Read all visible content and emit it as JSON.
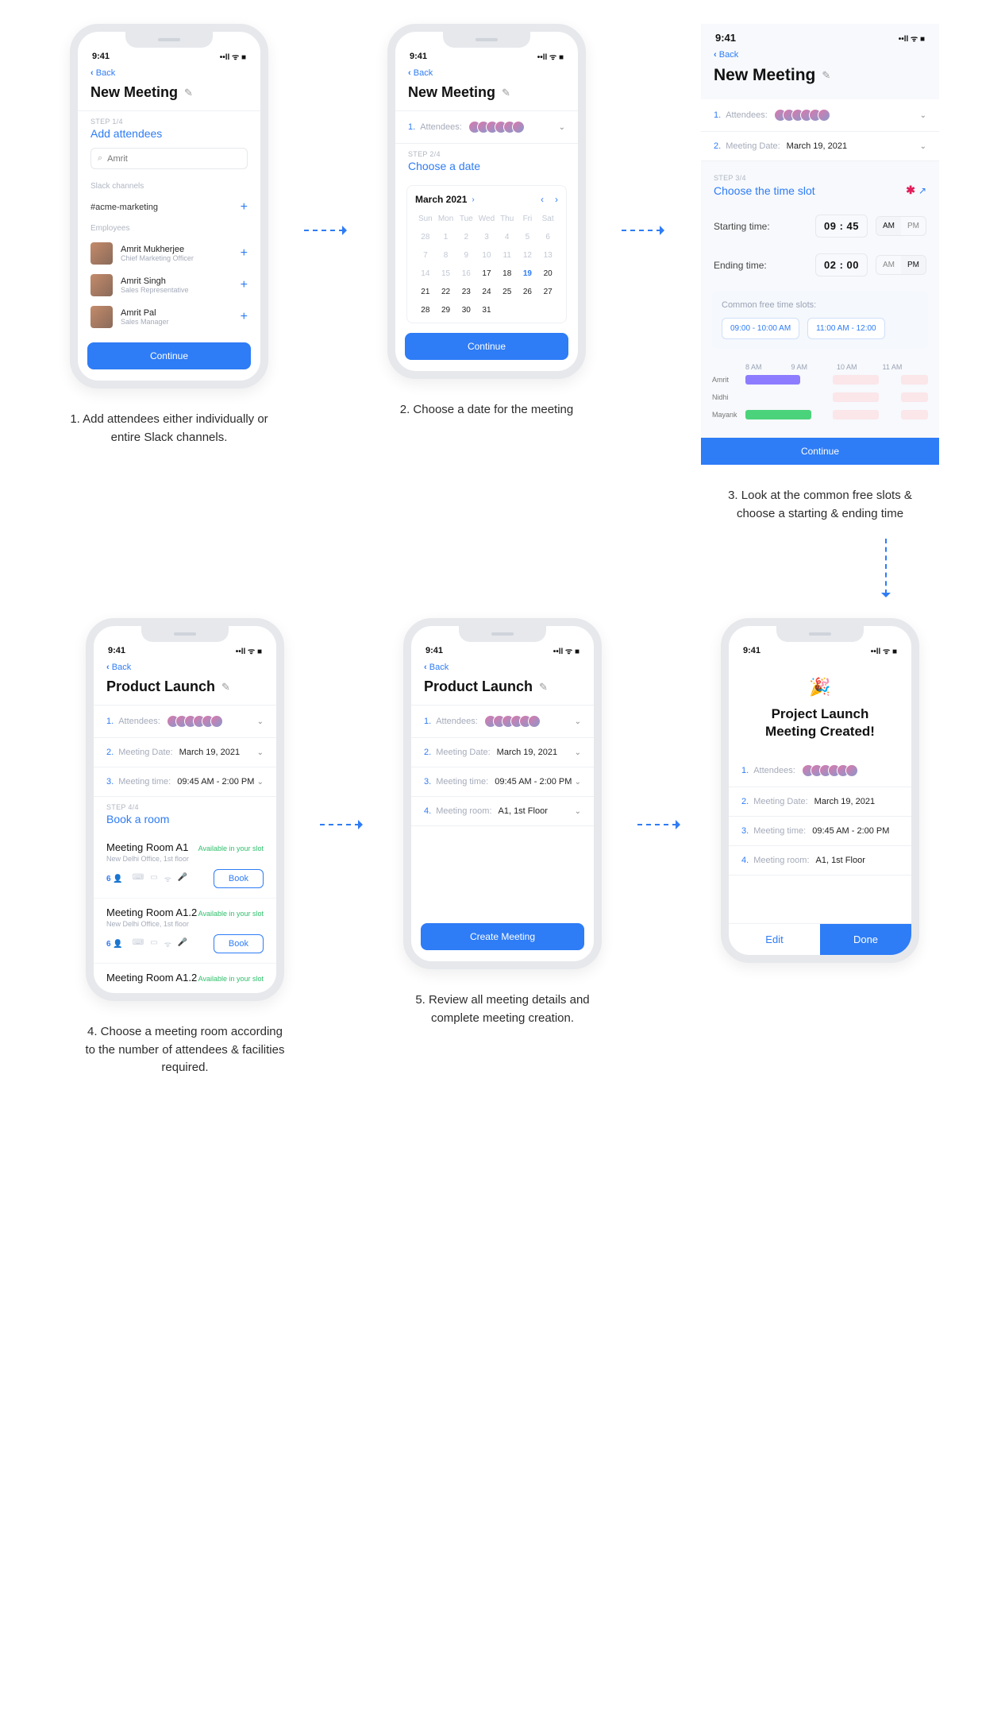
{
  "statusbar": {
    "time": "9:41",
    "right": "••ll  ᯤ  ■"
  },
  "back": "Back",
  "s1": {
    "title": "New Meeting",
    "step_label": "STEP 1/4",
    "heading": "Add attendees",
    "search_value": "Amrit",
    "channels_label": "Slack channels",
    "channel": "#acme-marketing",
    "employees_label": "Employees",
    "emp0_name": "Amrit Mukherjee",
    "emp0_role": "Chief Marketing Officer",
    "emp1_name": "Amrit Singh",
    "emp1_role": "Sales Representative",
    "emp2_name": "Amrit Pal",
    "emp2_role": "Sales Manager",
    "continue": "Continue",
    "caption": "1. Add attendees either individually or entire Slack channels."
  },
  "s2": {
    "title": "New Meeting",
    "attendees_label": "Attendees:",
    "step_label": "STEP 2/4",
    "heading": "Choose a date",
    "month": "March 2021",
    "dow": [
      "Sun",
      "Mon",
      "Tue",
      "Wed",
      "Thu",
      "Fri",
      "Sat"
    ],
    "days_prev": [
      28,
      1,
      2,
      3,
      4,
      5,
      6,
      7,
      8,
      9,
      10,
      11,
      12,
      13,
      14,
      15,
      16
    ],
    "days_cur": [
      17,
      18
    ],
    "day_sel": 19,
    "days_after": [
      20,
      21,
      22,
      23,
      24,
      25,
      26,
      27,
      28,
      29,
      30,
      31
    ],
    "continue": "Continue",
    "caption": "2. Choose a date for the meeting"
  },
  "s3": {
    "title": "New Meeting",
    "attendees_label": "Attendees:",
    "date_label": "Meeting Date:",
    "date_value": "March 19, 2021",
    "step_label": "STEP 3/4",
    "heading": "Choose the time slot",
    "start_label": "Starting time:",
    "start_value": "09 : 45",
    "start_am": "AM",
    "pm": "PM",
    "end_label": "Ending time:",
    "end_value": "02 : 00",
    "free_title": "Common free time slots:",
    "free0": "09:00 - 10:00 AM",
    "free1": "11:00 AM - 12:00",
    "tl_labels": [
      "8 AM",
      "9 AM",
      "10 AM",
      "11 AM"
    ],
    "who0": "Amrit",
    "who1": "Nidhi",
    "who2": "Mayank",
    "continue": "Continue",
    "caption": "3. Look at the common free slots & choose a starting & ending time"
  },
  "s4": {
    "title": "Product Launch",
    "attendees_label": "Attendees:",
    "date_label": "Meeting Date:",
    "date_value": "March 19, 2021",
    "time_label": "Meeting time:",
    "time_value": "09:45 AM - 2:00 PM",
    "step_label": "STEP 4/4",
    "heading": "Book a room",
    "r0_name": "Meeting Room A1",
    "r0_loc": "New Delhi Office, 1st floor",
    "r_avail": "Available in your slot",
    "cap": "6 👤",
    "book": "Book",
    "r1_name": "Meeting Room A1.2",
    "r1_loc": "New Delhi Office, 1st floor",
    "r2_name": "Meeting Room A1.2",
    "caption": "4. Choose a meeting room according to the number of attendees & facilities required."
  },
  "s5": {
    "title": "Product Launch",
    "attendees_label": "Attendees:",
    "date_label": "Meeting Date:",
    "date_value": "March 19, 2021",
    "time_label": "Meeting time:",
    "time_value": "09:45 AM - 2:00 PM",
    "room_label": "Meeting room:",
    "room_value": "A1, 1st Floor",
    "create": "Create Meeting",
    "caption": "5. Review all meeting details and complete meeting creation."
  },
  "s6": {
    "emoji": "🎉",
    "created_title": "Project Launch Meeting Created!",
    "attendees_label": "Attendees:",
    "date_label": "Meeting Date:",
    "date_value": "March 19, 2021",
    "time_label": "Meeting time:",
    "time_value": "09:45 AM - 2:00 PM",
    "room_label": "Meeting room:",
    "room_value": "A1, 1st Floor",
    "edit": "Edit",
    "done": "Done"
  }
}
